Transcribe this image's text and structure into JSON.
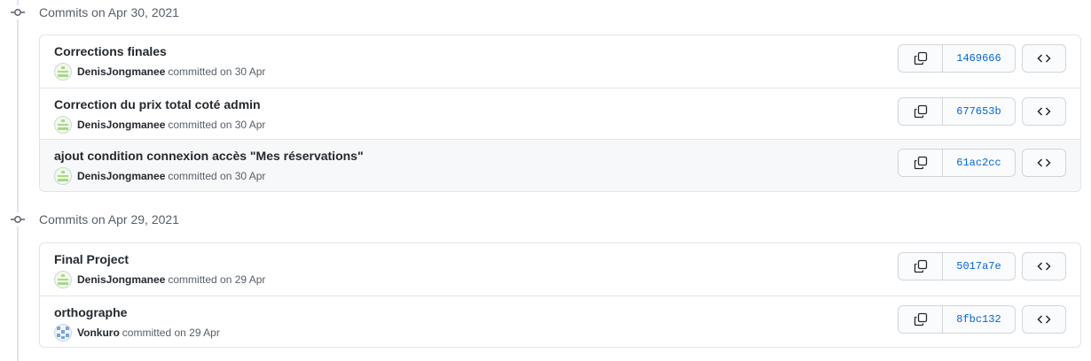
{
  "groups": [
    {
      "title": "Commits on Apr 30, 2021",
      "commits": [
        {
          "message": "Corrections finales",
          "author": "DenisJongmanee",
          "committed": "committed on 30 Apr",
          "sha": "1469666",
          "avatar": "green"
        },
        {
          "message": "Correction du prix total coté admin",
          "author": "DenisJongmanee",
          "committed": "committed on 30 Apr",
          "sha": "677653b",
          "avatar": "green"
        },
        {
          "message": "ajout condition connexion accès \"Mes réservations\"",
          "author": "DenisJongmanee",
          "committed": "committed on 30 Apr",
          "sha": "61ac2cc",
          "avatar": "green"
        }
      ]
    },
    {
      "title": "Commits on Apr 29, 2021",
      "commits": [
        {
          "message": "Final Project",
          "author": "DenisJongmanee",
          "committed": "committed on 29 Apr",
          "sha": "5017a7e",
          "avatar": "green"
        },
        {
          "message": "orthographe",
          "author": "Vonkuro",
          "committed": "committed on 29 Apr",
          "sha": "8fbc132",
          "avatar": "blue"
        }
      ]
    }
  ],
  "icons": {
    "copy": "copy-icon",
    "browse": "code-icon",
    "node": "git-commit-icon"
  },
  "colors": {
    "sha_link": "#0366d6",
    "avatar_green": "#a8d987",
    "avatar_blue": "#7aa3d8"
  }
}
